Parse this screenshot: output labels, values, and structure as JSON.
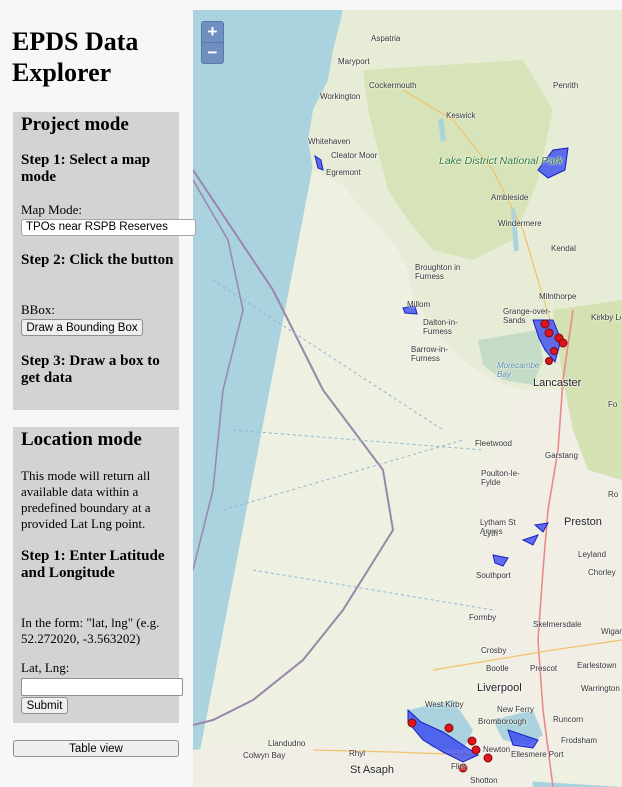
{
  "app": {
    "title": "EPDS Data Explorer"
  },
  "project_mode": {
    "heading": "Project mode",
    "step1": "Step 1: Select a map mode",
    "map_mode_label": "Map Mode:",
    "map_mode_value": "TPOs near RSPB Reserves",
    "step2": "Step 2: Click the button",
    "bbox_label": "BBox:",
    "bbox_button": "Draw a Bounding Box",
    "step3": "Step 3: Draw a box to get data"
  },
  "location_mode": {
    "heading": "Location mode",
    "description": "This mode will return all available data within a predefined boundary at a provided Lat Lng point.",
    "step1": "Step 1: Enter Latitude and Longitude",
    "form_hint": "In the form: \"lat, lng\" (e.g. 52.272020, -3.563202)",
    "latlng_label": "Lat, Lng:",
    "latlng_value": "",
    "submit_button": "Submit"
  },
  "table_view_button": "Table view",
  "map": {
    "zoom_in": "+",
    "zoom_out": "−",
    "colors": {
      "sea": "#aad3df",
      "land": "#f2efe9",
      "polygon": "#2f3ff0",
      "marker": "#e0141b"
    },
    "labels": [
      "Aspatria",
      "Maryport",
      "Cockermouth",
      "Workington",
      "Penrith",
      "Keswick",
      "Whitehaven",
      "Cleator Moor",
      "Egremont",
      "Lake District National Park",
      "Ambleside",
      "Windermere",
      "Kendal",
      "Broughton in Furness",
      "Millom",
      "Dalton-in-Furness",
      "Barrow-in-Furness",
      "Grange-over-Sands",
      "Milnthorpe",
      "Kirkby Lonsdale",
      "Morecambe Bay",
      "Lancaster",
      "Fleetwood",
      "Garstang",
      "Poulton-le-Fylde",
      "Lytham St Annes",
      "Preston",
      "Southport",
      "Leyland",
      "Chorley",
      "Formby",
      "Skelmersdale",
      "Crosby",
      "Bootle",
      "Liverpool",
      "Prescot",
      "Earlestown",
      "Warrington",
      "West Kirby",
      "New Ferry",
      "Bromborough",
      "Runcorn",
      "Frodsham",
      "Ellesmere Port",
      "Llandudno",
      "Colwyn Bay",
      "Rhyl",
      "St Asaph",
      "Shotton",
      "Flint",
      "Wigan",
      "Lyth",
      "Fo",
      "Ro",
      "Newton"
    ]
  }
}
